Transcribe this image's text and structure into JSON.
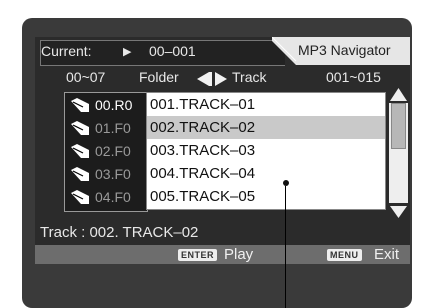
{
  "header": {
    "current_label": "Current:",
    "play_icon": "▶",
    "current_value": "00–001",
    "navigator_label": "MP3 Navigator"
  },
  "columns": {
    "folder_range": "00~07",
    "folder_label": "Folder",
    "track_label": "Track",
    "track_range": "001~015"
  },
  "folders": [
    {
      "label": "00.R0",
      "state": "active"
    },
    {
      "label": "01.F0",
      "state": "inactive"
    },
    {
      "label": "02.F0",
      "state": "inactive"
    },
    {
      "label": "03.F0",
      "state": "inactive"
    },
    {
      "label": "04.F0",
      "state": "inactive"
    }
  ],
  "tracks": [
    {
      "label": "001.TRACK–01",
      "selected": false
    },
    {
      "label": "002.TRACK–02",
      "selected": true
    },
    {
      "label": "003.TRACK–03",
      "selected": false
    },
    {
      "label": "004.TRACK–04",
      "selected": false
    },
    {
      "label": "005.TRACK–05",
      "selected": false
    }
  ],
  "status": "Track : 002. TRACK–02",
  "footer": {
    "enter_key": "ENTER",
    "play_label": "Play",
    "menu_key": "MENU",
    "exit_label": "Exit"
  },
  "colors": {
    "screen_bg": "#3a3a3a",
    "list_bg": "#ffffff",
    "selected_row": "#c9c9c9",
    "footer_bar": "#6d6d6d"
  }
}
